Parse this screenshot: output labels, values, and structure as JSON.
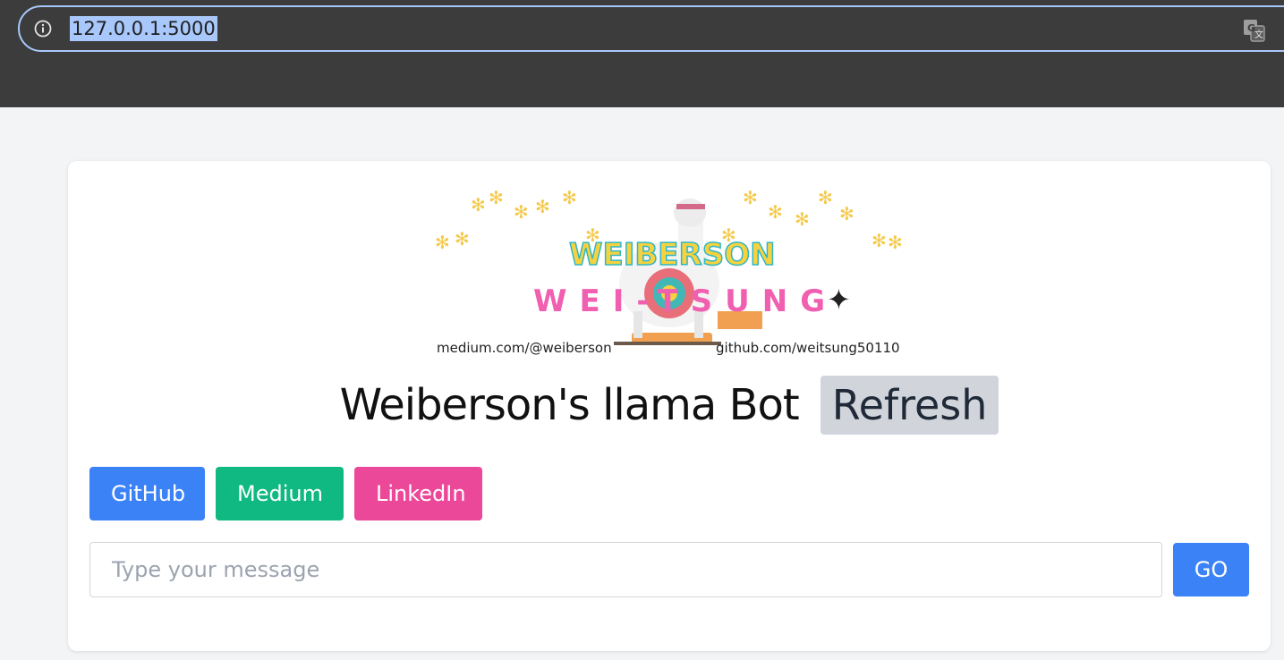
{
  "browser": {
    "url": "127.0.0.1:5000",
    "info_icon": "info-icon",
    "translate_icon": "translate-icon"
  },
  "banner": {
    "line1": "WEIBERSON",
    "line2": "WEI-TSUNG",
    "sparkle": "✦",
    "left_link": "medium.com/@weiberson",
    "right_link": "github.com/weitsung50110",
    "colors": {
      "yellow": "#f7d23e",
      "pink": "#f05fb0",
      "teal": "#2fb7c4",
      "flower": "#f5c94b"
    }
  },
  "header": {
    "title": "Weiberson's llama Bot",
    "refresh_label": "Refresh"
  },
  "links": {
    "github": "GitHub",
    "medium": "Medium",
    "linkedin": "LinkedIn"
  },
  "chat": {
    "placeholder": "Type your message",
    "value": "",
    "go_label": "GO"
  },
  "colors": {
    "blue": "#3b82f6",
    "green": "#10b981",
    "pink": "#ec4899",
    "gray": "#d1d5db"
  }
}
